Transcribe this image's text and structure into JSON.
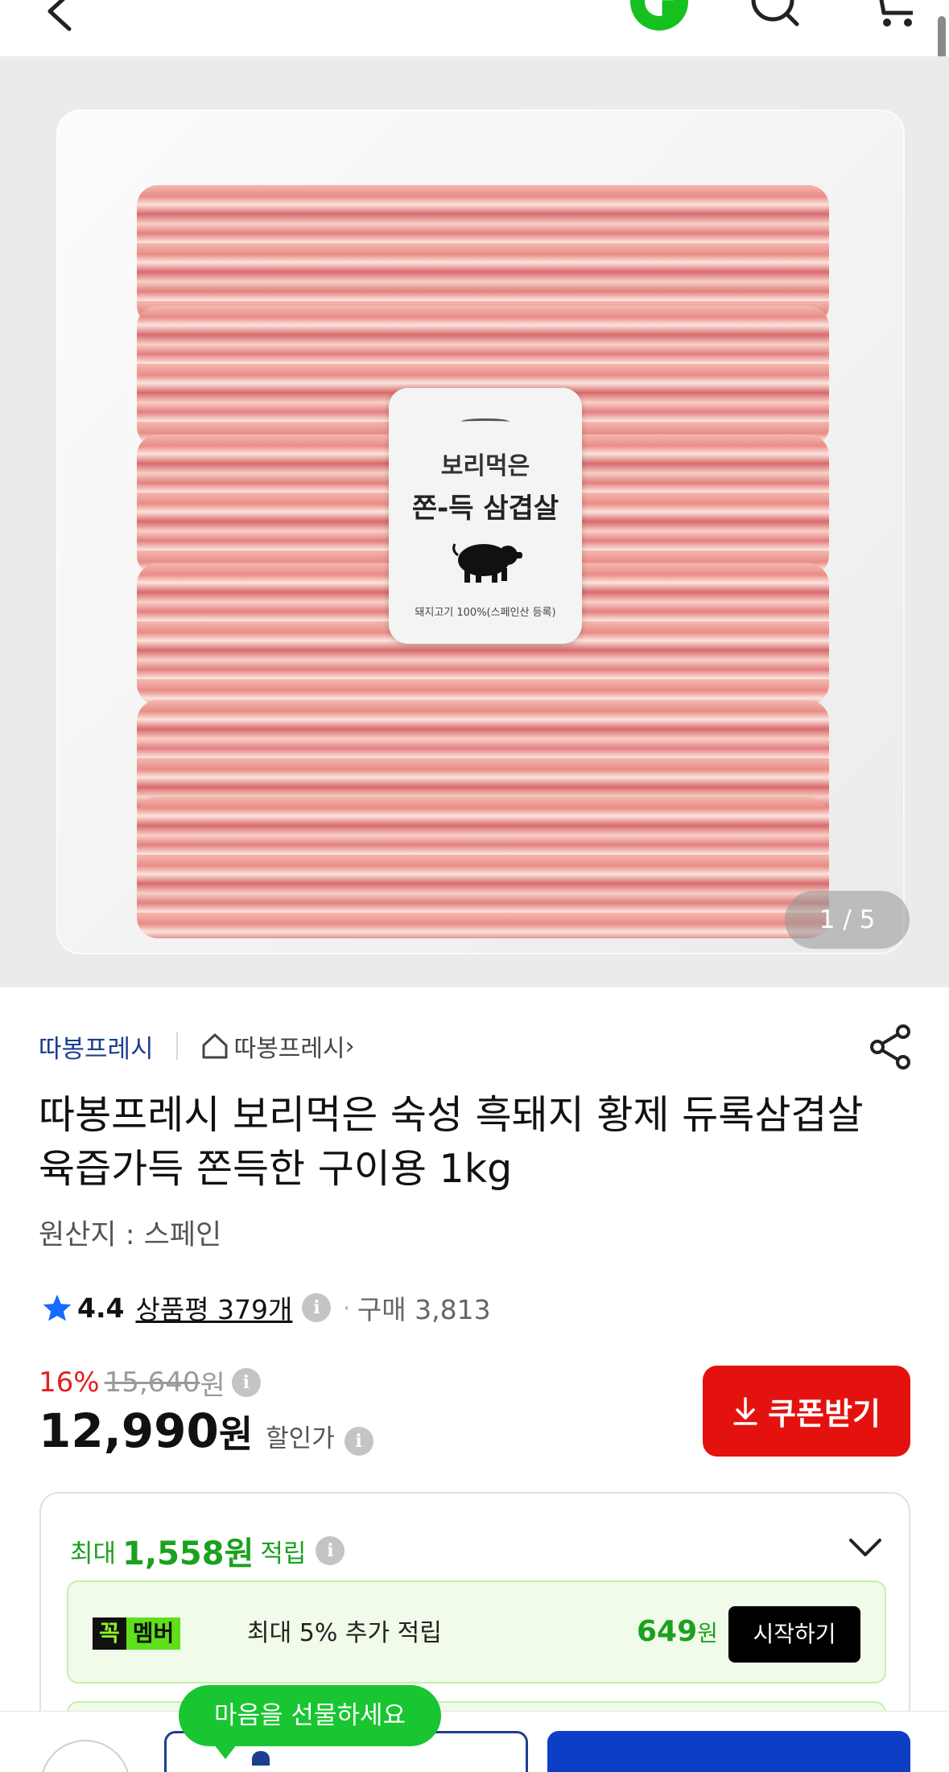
{
  "colors": {
    "accent_green": "#1ba11f",
    "link_blue": "#1d3e8f",
    "discount_red": "#e31f1f",
    "coupon_red": "#e3120f",
    "buy_blue": "#0d3fc6",
    "tooltip_green": "#19c531"
  },
  "header": {
    "icons": [
      "back-icon",
      "gmarket-g-logo",
      "search-icon",
      "cart-icon"
    ]
  },
  "gallery": {
    "pager": "1 / 5",
    "label": {
      "brand": "보리먹은",
      "name": "쫀-득 삼겹살",
      "origin": "돼지고기 100%(스페인산 등록)"
    }
  },
  "product": {
    "seller": "따봉프레시",
    "store": "따봉프레시",
    "store_chevron": "›",
    "title": "따봉프레시 보리먹은 숙성 흑돼지 황제 듀록삼겹살 육즙가득 쫀득한 구이용 1kg",
    "origin": "원산지 : 스페인",
    "rating": "4.4",
    "reviews": "상품평 379개",
    "purchases": "구매 3,813",
    "mid_dot": "·",
    "discount_rate": "16%",
    "original_price": "15,640",
    "won": "원",
    "price": "12,990",
    "price_label": "할인가",
    "info_icon": "i"
  },
  "coupon": {
    "label": "쿠폰받기"
  },
  "rewards": {
    "prefix": "최대",
    "amount": "1,558원",
    "suffix": "적립",
    "member": {
      "badge_left": "꼭",
      "badge_right": "멤버",
      "text": "최대 5% 추가 적립",
      "points": "649",
      "points_unit": "원",
      "button": "시작하기"
    }
  },
  "bottom": {
    "tooltip": "마음을 선물하세요"
  }
}
